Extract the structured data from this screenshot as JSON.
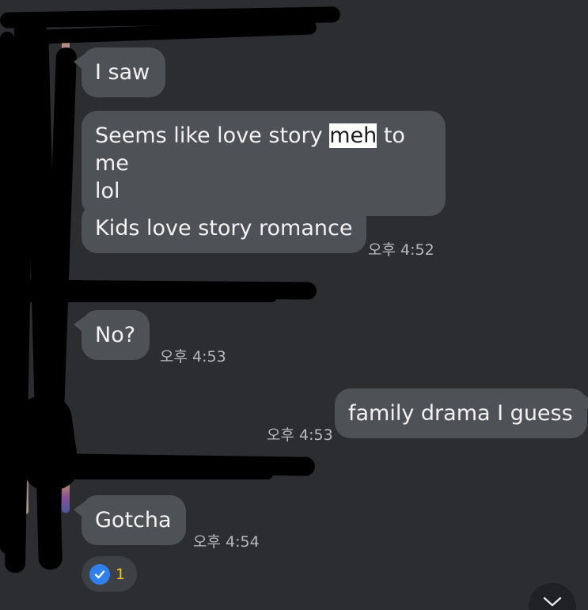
{
  "messages": [
    {
      "text": "I saw"
    },
    {
      "text_before": "Seems like love story ",
      "highlight": "meh",
      "text_line1_after": " to me",
      "text_line2": "lol"
    },
    {
      "text": "Kids love story romance",
      "time": "오후 4:52"
    },
    {
      "text": "No?",
      "time": "오후 4:53"
    },
    {
      "text": "family drama I guess",
      "time": "오후 4:53"
    },
    {
      "text": "Gotcha",
      "time": "오후 4:54"
    }
  ],
  "reaction": {
    "icon": "check-icon",
    "count": "1",
    "count_color": "#f0c330",
    "check_color": "#2f80ed"
  },
  "scroll_button": {
    "icon": "chevron-down-icon"
  },
  "colors": {
    "background": "#2b2d31",
    "bubble": "#4e5155",
    "text": "#f2f2f2",
    "timestamp": "#b8b9bb"
  }
}
